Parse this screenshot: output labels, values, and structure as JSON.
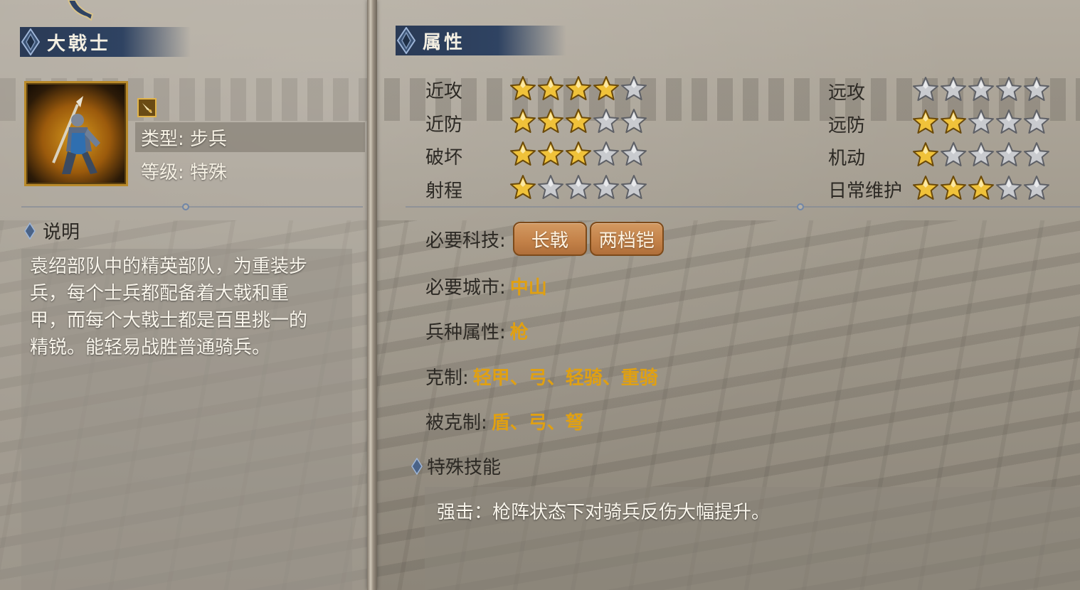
{
  "unit": {
    "name": "大戟士",
    "type_line": "类型: 步兵",
    "level_line": "等级: 特殊"
  },
  "description": {
    "heading": "说明",
    "text": "袁绍部队中的精英部队，为重装步兵，每个士兵都配备着大戟和重甲，而每个大戟士都是百里挑一的精锐。能轻易战胜普通骑兵。"
  },
  "attributes": {
    "heading": "属性",
    "max_stars": 5,
    "left": [
      {
        "label": "近攻",
        "stars": 4
      },
      {
        "label": "近防",
        "stars": 3
      },
      {
        "label": "破坏",
        "stars": 3
      },
      {
        "label": "射程",
        "stars": 1
      }
    ],
    "right": [
      {
        "label": "远攻",
        "stars": 0
      },
      {
        "label": "远防",
        "stars": 2
      },
      {
        "label": "机动",
        "stars": 1
      },
      {
        "label": "日常维护",
        "stars": 3
      }
    ]
  },
  "requirements": {
    "tech_label": "必要科技:",
    "techs": [
      "长戟",
      "两档铠"
    ],
    "city_label": "必要城市:",
    "city": "中山",
    "branch_label": "兵种属性:",
    "branch": "枪",
    "counters_label": "克制:",
    "counters": "轻甲、弓、轻骑、重骑",
    "countered_label": "被克制:",
    "countered_by": "盾、弓、弩"
  },
  "special": {
    "heading": "特殊技能",
    "text": "强击：枪阵状态下对骑兵反伤大幅提升。"
  },
  "colors": {
    "accent_value": "#e0a012",
    "ribbon": "#2f4362",
    "star_filled": "#f0c23a",
    "star_empty": "#c9cbcf"
  }
}
